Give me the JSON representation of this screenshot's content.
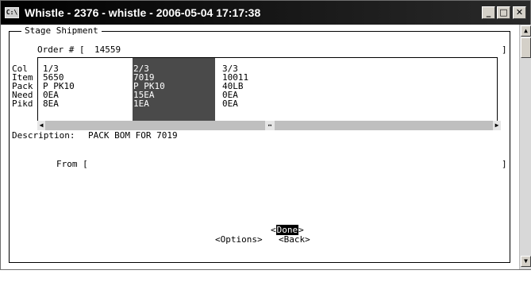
{
  "window": {
    "title": "Whistle - 2376 - whistle - 2006-05-04 17:17:38",
    "icon_text": "C:\\",
    "controls": {
      "minimize": "_",
      "maximize": "□",
      "close": "✕"
    }
  },
  "frame": {
    "title": "Stage Shipment"
  },
  "order": {
    "label": "Order # [",
    "value": "14559",
    "close": "]"
  },
  "grid": {
    "row_labels": [
      "Col",
      "Item",
      "Pack",
      "Need",
      "Pikd"
    ],
    "columns": [
      {
        "col": "1/3",
        "item": "5650",
        "pack": "P PK10",
        "need": "0EA",
        "pikd": "8EA"
      },
      {
        "col": "2/3",
        "item": "7019",
        "pack": "P PK10",
        "need": "15EA",
        "pikd": "1EA"
      },
      {
        "col": "3/3",
        "item": "10011",
        "pack": "40LB",
        "need": "0EA",
        "pikd": "0EA"
      }
    ],
    "selected_column": 1
  },
  "description": {
    "label": "Description:",
    "value": "PACK BOM FOR 7019"
  },
  "from": {
    "label": "From [",
    "value": "",
    "close": "]"
  },
  "buttons": {
    "done": "Done",
    "options": "Options",
    "back": "Back"
  },
  "colors": {
    "titlebar": "#000000",
    "selection": "#4a4a4a",
    "background": "#ffffff"
  },
  "icons": [
    "app-console-icon",
    "minimize-icon",
    "maximize-icon",
    "close-icon",
    "scroll-left-icon",
    "scroll-right-icon",
    "scroll-up-icon",
    "scroll-down-icon"
  ]
}
